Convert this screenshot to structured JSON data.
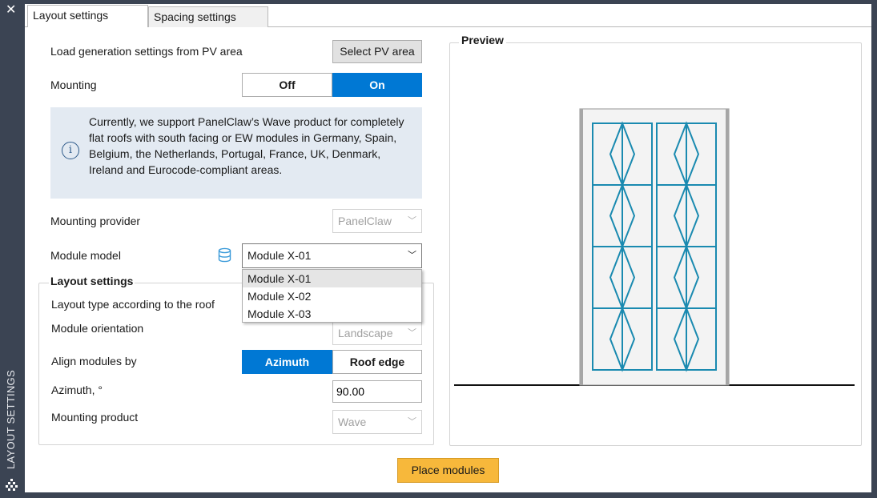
{
  "sidebar": {
    "close_label": "✕",
    "title": "LAYOUT SETTINGS"
  },
  "tabs": [
    {
      "label": "Layout settings"
    },
    {
      "label": "Spacing settings"
    }
  ],
  "load": {
    "label": "Load generation settings from PV area",
    "button": "Select PV area"
  },
  "mounting": {
    "label": "Mounting",
    "off": "Off",
    "on": "On",
    "selected": "On"
  },
  "info": {
    "text": "Currently, we support PanelClaw’s Wave product for completely flat roofs with south facing or EW modules in Germany, Spain, Belgium, the Netherlands, Portugal, France, UK, Denmark, Ireland and Eurocode-compliant areas."
  },
  "mounting_provider": {
    "label": "Mounting provider",
    "value": "PanelClaw"
  },
  "module_model": {
    "label": "Module model",
    "value": "Module X-01",
    "options": [
      "Module X-01",
      "Module X-02",
      "Module X-03"
    ]
  },
  "layout_group": {
    "title": "Layout settings",
    "layout_type_label": "Layout type according to the roof",
    "orientation_label": "Module orientation",
    "orientation_value": "Landscape",
    "align_label": "Align modules by",
    "align_azimuth": "Azimuth",
    "align_roof_edge": "Roof edge",
    "align_selected": "Azimuth",
    "azimuth_label": "Azimuth, °",
    "azimuth_value": "90.00",
    "product_label": "Mounting product",
    "product_value": "Wave"
  },
  "preview": {
    "title": "Preview",
    "columns": 2,
    "rows": 4
  },
  "actions": {
    "place_modules": "Place modules"
  },
  "colors": {
    "accent": "#0078d4",
    "module_stroke": "#1a8ab0",
    "place_button": "#f7b83b",
    "info_bg": "#e3eaf2"
  }
}
